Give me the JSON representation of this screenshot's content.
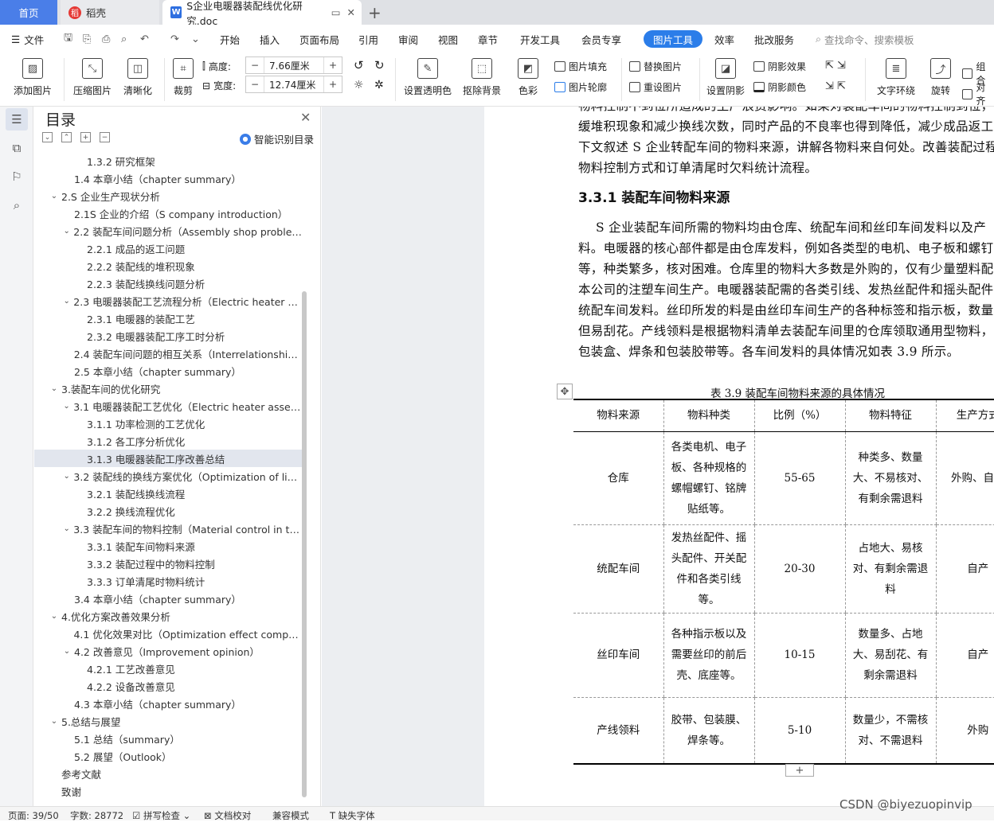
{
  "tabs": {
    "home": "首页",
    "daoke": "稻壳",
    "doc": "S企业电暖器装配线优化研究.doc",
    "add": "+"
  },
  "menubar": {
    "file": "文件",
    "items": [
      "开始",
      "插入",
      "页面布局",
      "引用",
      "审阅",
      "视图",
      "章节",
      "开发工具",
      "会员专享",
      "图片工具",
      "效率",
      "批改服务"
    ],
    "search": "查找命令、搜索模板"
  },
  "ribbon": {
    "add_picture": "添加图片",
    "compress": "压缩图片",
    "sharpen": "清晰化",
    "crop": "裁剪",
    "height_label": "高度:",
    "height_value": "7.66厘米",
    "width_label": "宽度:",
    "width_value": "12.74厘米",
    "transparent": "设置透明色",
    "remove_bg": "抠除背景",
    "color": "色彩",
    "fill": "图片填充",
    "outline": "图片轮廓",
    "replace": "替换图片",
    "reset": "重设图片",
    "shadow": "设置阴影",
    "shadow_effect": "阴影效果",
    "shadow_color": "阴影颜色",
    "wrap": "文字环绕",
    "rotate": "旋转",
    "group": "组合",
    "align": "对齐"
  },
  "toc": {
    "title": "目录",
    "ai": "智能识别目录",
    "items": [
      {
        "text": "1.3.2 研究框架",
        "level": 3,
        "arrow": ""
      },
      {
        "text": "1.4 本章小结（chapter summary）",
        "level": 2,
        "arrow": ""
      },
      {
        "text": "2.S 企业生产现状分析",
        "level": 1,
        "arrow": "v"
      },
      {
        "text": "2.1S 企业的介绍（S company introduction）",
        "level": 2,
        "arrow": ""
      },
      {
        "text": "2.2 装配车间问题分析（Assembly shop problem ...",
        "level": 2,
        "arrow": "v"
      },
      {
        "text": "2.2.1 成品的返工问题",
        "level": 3,
        "arrow": ""
      },
      {
        "text": "2.2.2 装配线的堆积现象",
        "level": 3,
        "arrow": ""
      },
      {
        "text": "2.2.3 装配线换线问题分析",
        "level": 3,
        "arrow": ""
      },
      {
        "text": "2.3 电暖器装配工艺流程分析（Electric heater ass...",
        "level": 2,
        "arrow": "v"
      },
      {
        "text": "2.3.1 电暖器的装配工艺",
        "level": 3,
        "arrow": ""
      },
      {
        "text": "2.3.2 电暖器装配工序工时分析",
        "level": 3,
        "arrow": ""
      },
      {
        "text": "2.4 装配车间问题的相互关系（Interrelationship ...",
        "level": 2,
        "arrow": ""
      },
      {
        "text": "2.5 本章小结（chapter summary）",
        "level": 2,
        "arrow": ""
      },
      {
        "text": "3.装配车间的优化研究",
        "level": 1,
        "arrow": "v"
      },
      {
        "text": "3.1 电暖器装配工艺优化（Electric heater assemb...",
        "level": 2,
        "arrow": "v"
      },
      {
        "text": "3.1.1 功率检测的工艺优化",
        "level": 3,
        "arrow": ""
      },
      {
        "text": "3.1.2 各工序分析优化",
        "level": 3,
        "arrow": ""
      },
      {
        "text": "3.1.3 电暖器装配工序改善总结",
        "level": 3,
        "arrow": "",
        "selected": true
      },
      {
        "text": "3.2 装配线的换线方案优化（Optimization of line ...",
        "level": 2,
        "arrow": "v"
      },
      {
        "text": "3.2.1 装配线换线流程",
        "level": 3,
        "arrow": ""
      },
      {
        "text": "3.2.2 换线流程优化",
        "level": 3,
        "arrow": ""
      },
      {
        "text": "3.3 装配车间的物料控制（Material control in the ...",
        "level": 2,
        "arrow": "v"
      },
      {
        "text": "3.3.1 装配车间物料来源",
        "level": 3,
        "arrow": ""
      },
      {
        "text": "3.3.2 装配过程中的物料控制",
        "level": 3,
        "arrow": ""
      },
      {
        "text": "3.3.3 订单清尾时物料统计",
        "level": 3,
        "arrow": ""
      },
      {
        "text": "3.4 本章小结（chapter summary）",
        "level": 2,
        "arrow": ""
      },
      {
        "text": "4.优化方案改善效果分析",
        "level": 1,
        "arrow": "v"
      },
      {
        "text": "4.1 优化效果对比（Optimization effect compari...",
        "level": 2,
        "arrow": ""
      },
      {
        "text": "4.2 改善意见（Improvement opinion）",
        "level": 2,
        "arrow": "v"
      },
      {
        "text": "4.2.1 工艺改善意见",
        "level": 3,
        "arrow": ""
      },
      {
        "text": "4.2.2 设备改善意见",
        "level": 3,
        "arrow": ""
      },
      {
        "text": "4.3 本章小结（chapter summary）",
        "level": 2,
        "arrow": ""
      },
      {
        "text": "5.总结与展望",
        "level": 1,
        "arrow": "v"
      },
      {
        "text": "5.1 总结（summary）",
        "level": 2,
        "arrow": ""
      },
      {
        "text": "5.2 展望（Outlook）",
        "level": 2,
        "arrow": ""
      },
      {
        "text": "参考文献",
        "level": 1,
        "arrow": ""
      },
      {
        "text": "致谢",
        "level": 1,
        "arrow": ""
      }
    ]
  },
  "doc": {
    "para1": [
      "物料控制不到位所造成的生产浪费影响。如果对装配车间的物料控制到位，就",
      "缓堆积现象和减少换线次数，同时产品的不良率也得到降低，减少成品返工次",
      "下文叙述 S 企业转配车间的物料来源，讲解各物料来自何处。改善装配过程",
      "物料控制方式和订单清尾时欠料统计流程。"
    ],
    "heading": "3.3.1 装配车间物料来源",
    "para2": [
      "S 企业装配车间所需的物料均由仓库、统配车间和丝印车间发料以及产",
      "料。电暖器的核心部件都是由仓库发料，例如各类型的电机、电子板和螺钉",
      "等，种类繁多，核对困难。仓库里的物料大多数是外购的，仅有少量塑料配",
      "本公司的注塑车间生产。电暖器装配需的各类引线、发热丝配件和摇头配件",
      "统配车间发料。丝印所发的料是由丝印车间生产的各种标签和指示板，数量",
      "但易刮花。产线领料是根据物料清单去装配车间里的仓库领取通用型物料，",
      "包装盒、焊条和包装胶带等。各车间发料的具体情况如表 3.9 所示。"
    ],
    "table_caption": "表 3.9 装配车间物料来源的具体情况",
    "table": {
      "headers": [
        "物料来源",
        "物料种类",
        "比例（%）",
        "物料特征",
        "生产方式"
      ],
      "rows": [
        {
          "source": "仓库",
          "kind": "各类电机、电子板、各种规格的螺帽螺钉、铭牌贴纸等。",
          "ratio": "55-65",
          "feature": "种类多、数量大、不易核对、有剩余需退料",
          "mode": "外购、自产"
        },
        {
          "source": "统配车间",
          "kind": "发热丝配件、摇头配件、开关配件和各类引线等。",
          "ratio": "20-30",
          "feature": "占地大、易核对、有剩余需退料",
          "mode": "自产"
        },
        {
          "source": "丝印车间",
          "kind": "各种指示板以及需要丝印的前后壳、底座等。",
          "ratio": "10-15",
          "feature": "数量多、占地大、易刮花、有剩余需退料",
          "mode": "自产"
        },
        {
          "source": "产线领料",
          "kind": "胶带、包装膜、焊条等。",
          "ratio": "5-10",
          "feature": "数量少，不需核对、不需退料",
          "mode": "外购"
        }
      ]
    }
  },
  "status": {
    "page": "页面: 39/50",
    "words": "字数: 28772",
    "spell": "拼写检查",
    "proof": "文档校对",
    "compat": "兼容模式",
    "missing_font": "缺失字体"
  },
  "watermark": "CSDN @biyezuopinvip"
}
